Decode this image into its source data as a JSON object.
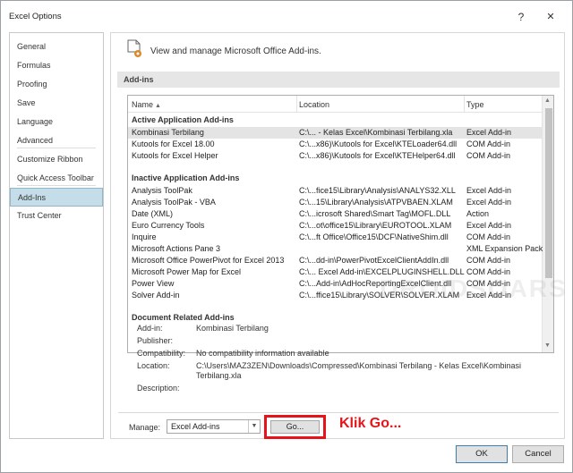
{
  "window": {
    "title": "Excel Options",
    "help_glyph": "?",
    "close_glyph": "✕"
  },
  "sidebar": {
    "items": [
      {
        "label": "General"
      },
      {
        "label": "Formulas"
      },
      {
        "label": "Proofing"
      },
      {
        "label": "Save"
      },
      {
        "label": "Language"
      },
      {
        "label": "Advanced"
      },
      {
        "label": "Customize Ribbon"
      },
      {
        "label": "Quick Access Toolbar"
      },
      {
        "label": "Add-Ins",
        "selected": true
      },
      {
        "label": "Trust Center"
      }
    ]
  },
  "header": {
    "text": "View and manage Microsoft Office Add-ins.",
    "icon": "addins-gear-icon"
  },
  "section": {
    "title": "Add-ins"
  },
  "list": {
    "columns": [
      "Name",
      "Location",
      "Type"
    ],
    "sort_glyph": "▲",
    "groups": [
      {
        "title": "Active Application Add-ins",
        "rows": [
          {
            "name": "Kombinasi Terbilang",
            "location": "C:\\... - Kelas Excel\\Kombinasi Terbilang.xla",
            "type": "Excel Add-in",
            "selected": true
          },
          {
            "name": "Kutools for Excel  18.00",
            "location": "C:\\...x86)\\Kutools for Excel\\KTELoader64.dll",
            "type": "COM Add-in"
          },
          {
            "name": "Kutools for Excel  Helper",
            "location": "C:\\...x86)\\Kutools for Excel\\KTEHelper64.dll",
            "type": "COM Add-in"
          }
        ]
      },
      {
        "title": "Inactive Application Add-ins",
        "rows": [
          {
            "name": "Analysis ToolPak",
            "location": "C:\\...fice15\\Library\\Analysis\\ANALYS32.XLL",
            "type": "Excel Add-in"
          },
          {
            "name": "Analysis ToolPak - VBA",
            "location": "C:\\...15\\Library\\Analysis\\ATPVBAEN.XLAM",
            "type": "Excel Add-in"
          },
          {
            "name": "Date (XML)",
            "location": "C:\\...icrosoft Shared\\Smart Tag\\MOFL.DLL",
            "type": "Action"
          },
          {
            "name": "Euro Currency Tools",
            "location": "C:\\...ot\\office15\\Library\\EUROTOOL.XLAM",
            "type": "Excel Add-in"
          },
          {
            "name": "Inquire",
            "location": "C:\\...ft Office\\Office15\\DCF\\NativeShim.dll",
            "type": "COM Add-in"
          },
          {
            "name": "Microsoft Actions Pane 3",
            "location": "",
            "type": "XML Expansion Pack"
          },
          {
            "name": "Microsoft Office PowerPivot for Excel 2013",
            "location": "C:\\...dd-in\\PowerPivotExcelClientAddIn.dll",
            "type": "COM Add-in"
          },
          {
            "name": "Microsoft Power Map for Excel",
            "location": "C:\\... Excel Add-in\\EXCELPLUGINSHELL.DLL",
            "type": "COM Add-in"
          },
          {
            "name": "Power View",
            "location": "C:\\...Add-in\\AdHocReportingExcelClient.dll",
            "type": "COM Add-in"
          },
          {
            "name": "Solver Add-in",
            "location": "C:\\...ffice15\\Library\\SOLVER\\SOLVER.XLAM",
            "type": "Excel Add-in"
          }
        ]
      },
      {
        "title": "Document Related Add-ins",
        "rows": []
      }
    ]
  },
  "details": {
    "addin_label": "Add-in:",
    "addin_value": "Kombinasi Terbilang",
    "publisher_label": "Publisher:",
    "publisher_value": "",
    "compat_label": "Compatibility:",
    "compat_value": "No compatibility information available",
    "location_label": "Location:",
    "location_value": "C:\\Users\\MAZ3ZEN\\Downloads\\Compressed\\Kombinasi Terbilang - Kelas Excel\\Kombinasi Terbilang.xla",
    "description_label": "Description:",
    "description_value": ""
  },
  "manage": {
    "label": "Manage:",
    "selected": "Excel Add-ins",
    "go_label": "Go...",
    "annotation": "Klik Go...",
    "annotation_color": "#e6141a"
  },
  "footer": {
    "ok": "OK",
    "cancel": "Cancel"
  },
  "watermark": "DROIDSOARS"
}
